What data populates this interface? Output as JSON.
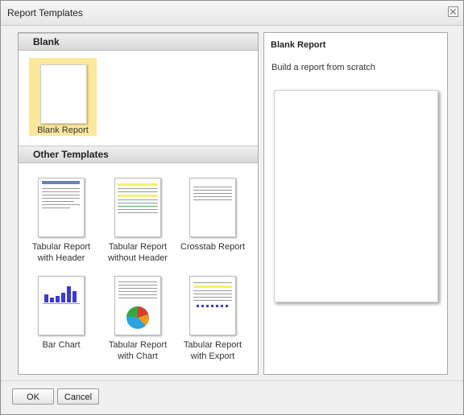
{
  "dialog": {
    "title": "Report Templates"
  },
  "sections": {
    "blank": "Blank",
    "other": "Other Templates"
  },
  "blank_template": {
    "label": "Blank Report",
    "selected": true
  },
  "templates": [
    {
      "line1": "Tabular Report",
      "line2": "with Header",
      "icon": "tabular-header-thumbnail"
    },
    {
      "line1": "Tabular Report",
      "line2": "without Header",
      "icon": "tabular-no-header-thumbnail"
    },
    {
      "line1": "Crosstab Report",
      "line2": "",
      "icon": "crosstab-thumbnail"
    },
    {
      "line1": "Bar Chart",
      "line2": "",
      "icon": "bar-chart-thumbnail"
    },
    {
      "line1": "Tabular Report",
      "line2": "with Chart",
      "icon": "tabular-chart-thumbnail"
    },
    {
      "line1": "Tabular Report",
      "line2": "with Export",
      "icon": "tabular-export-thumbnail"
    }
  ],
  "preview": {
    "title": "Blank Report",
    "description": "Build a report from scratch"
  },
  "buttons": {
    "ok": "OK",
    "cancel": "Cancel"
  },
  "colors": {
    "selection": "#fbe89c",
    "bar": "#3b3bc9",
    "highlight_row": "#f5f070"
  }
}
